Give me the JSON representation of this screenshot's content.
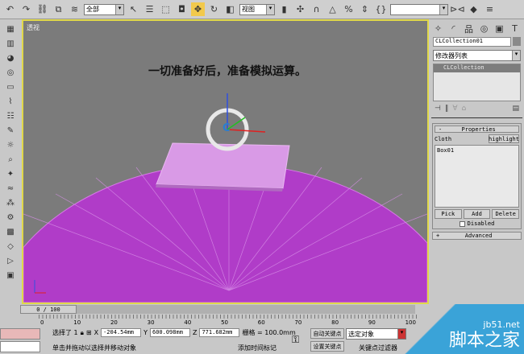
{
  "toolbar": {
    "selection_filter": "全部",
    "coord_system": "视图",
    "named_selection": ""
  },
  "viewport": {
    "label": "透视",
    "caption": "一切准备好后，准备模拟运算。",
    "gizmo_label": "C"
  },
  "panel": {
    "object_name": "CLCollection01",
    "modifier_list": "修改器列表",
    "stack_item": "CLCollection",
    "rollout_properties": "Properties",
    "cloth_label": "Cloth",
    "highlight": "highlight",
    "list_items": [
      "Box01"
    ],
    "pick": "Pick",
    "add": "Add",
    "delete": "Delete",
    "disabled": "Disabled",
    "rollout_advanced": "Advanced",
    "properties_sign": "-",
    "advanced_sign": "+"
  },
  "timeline": {
    "frame": "0 / 100",
    "ticks": [
      "0",
      "10",
      "20",
      "30",
      "40",
      "50",
      "60",
      "70",
      "80",
      "90",
      "100"
    ]
  },
  "status": {
    "selected": "选择了 1",
    "x": "-204.54mm",
    "y": "600.098mm",
    "z": "771.682mm",
    "grid": "栅格 = 100.0mm",
    "prompt": "单击并拖动以选择并移动对象",
    "add_time_tag": "添加时间标记",
    "auto_key": "自动关键点",
    "set_key": "设置关键点",
    "key_mode": "选定对象",
    "key_filters": "关键点过滤器",
    "x_label": "X",
    "y_label": "Y",
    "z_label": "Z"
  },
  "watermark": {
    "site": "jb51.net",
    "name": "脚本之家"
  },
  "colors": {
    "sphere": "#b03cc8",
    "cloth": "#d99ae6",
    "viewport": "#7b7b7b",
    "active_border": "#e0d84a"
  }
}
